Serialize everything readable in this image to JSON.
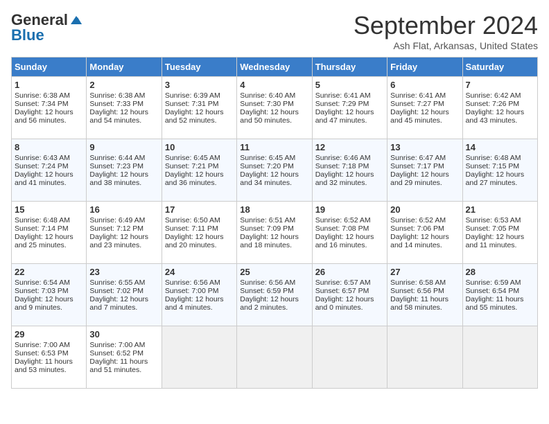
{
  "header": {
    "logo_line1": "General",
    "logo_line2": "Blue",
    "month": "September 2024",
    "location": "Ash Flat, Arkansas, United States"
  },
  "days_of_week": [
    "Sunday",
    "Monday",
    "Tuesday",
    "Wednesday",
    "Thursday",
    "Friday",
    "Saturday"
  ],
  "weeks": [
    [
      {
        "day": "1",
        "info": "Sunrise: 6:38 AM\nSunset: 7:34 PM\nDaylight: 12 hours and 56 minutes."
      },
      {
        "day": "2",
        "info": "Sunrise: 6:38 AM\nSunset: 7:33 PM\nDaylight: 12 hours and 54 minutes."
      },
      {
        "day": "3",
        "info": "Sunrise: 6:39 AM\nSunset: 7:31 PM\nDaylight: 12 hours and 52 minutes."
      },
      {
        "day": "4",
        "info": "Sunrise: 6:40 AM\nSunset: 7:30 PM\nDaylight: 12 hours and 50 minutes."
      },
      {
        "day": "5",
        "info": "Sunrise: 6:41 AM\nSunset: 7:29 PM\nDaylight: 12 hours and 47 minutes."
      },
      {
        "day": "6",
        "info": "Sunrise: 6:41 AM\nSunset: 7:27 PM\nDaylight: 12 hours and 45 minutes."
      },
      {
        "day": "7",
        "info": "Sunrise: 6:42 AM\nSunset: 7:26 PM\nDaylight: 12 hours and 43 minutes."
      }
    ],
    [
      {
        "day": "8",
        "info": "Sunrise: 6:43 AM\nSunset: 7:24 PM\nDaylight: 12 hours and 41 minutes."
      },
      {
        "day": "9",
        "info": "Sunrise: 6:44 AM\nSunset: 7:23 PM\nDaylight: 12 hours and 38 minutes."
      },
      {
        "day": "10",
        "info": "Sunrise: 6:45 AM\nSunset: 7:21 PM\nDaylight: 12 hours and 36 minutes."
      },
      {
        "day": "11",
        "info": "Sunrise: 6:45 AM\nSunset: 7:20 PM\nDaylight: 12 hours and 34 minutes."
      },
      {
        "day": "12",
        "info": "Sunrise: 6:46 AM\nSunset: 7:18 PM\nDaylight: 12 hours and 32 minutes."
      },
      {
        "day": "13",
        "info": "Sunrise: 6:47 AM\nSunset: 7:17 PM\nDaylight: 12 hours and 29 minutes."
      },
      {
        "day": "14",
        "info": "Sunrise: 6:48 AM\nSunset: 7:15 PM\nDaylight: 12 hours and 27 minutes."
      }
    ],
    [
      {
        "day": "15",
        "info": "Sunrise: 6:48 AM\nSunset: 7:14 PM\nDaylight: 12 hours and 25 minutes."
      },
      {
        "day": "16",
        "info": "Sunrise: 6:49 AM\nSunset: 7:12 PM\nDaylight: 12 hours and 23 minutes."
      },
      {
        "day": "17",
        "info": "Sunrise: 6:50 AM\nSunset: 7:11 PM\nDaylight: 12 hours and 20 minutes."
      },
      {
        "day": "18",
        "info": "Sunrise: 6:51 AM\nSunset: 7:09 PM\nDaylight: 12 hours and 18 minutes."
      },
      {
        "day": "19",
        "info": "Sunrise: 6:52 AM\nSunset: 7:08 PM\nDaylight: 12 hours and 16 minutes."
      },
      {
        "day": "20",
        "info": "Sunrise: 6:52 AM\nSunset: 7:06 PM\nDaylight: 12 hours and 14 minutes."
      },
      {
        "day": "21",
        "info": "Sunrise: 6:53 AM\nSunset: 7:05 PM\nDaylight: 12 hours and 11 minutes."
      }
    ],
    [
      {
        "day": "22",
        "info": "Sunrise: 6:54 AM\nSunset: 7:03 PM\nDaylight: 12 hours and 9 minutes."
      },
      {
        "day": "23",
        "info": "Sunrise: 6:55 AM\nSunset: 7:02 PM\nDaylight: 12 hours and 7 minutes."
      },
      {
        "day": "24",
        "info": "Sunrise: 6:56 AM\nSunset: 7:00 PM\nDaylight: 12 hours and 4 minutes."
      },
      {
        "day": "25",
        "info": "Sunrise: 6:56 AM\nSunset: 6:59 PM\nDaylight: 12 hours and 2 minutes."
      },
      {
        "day": "26",
        "info": "Sunrise: 6:57 AM\nSunset: 6:57 PM\nDaylight: 12 hours and 0 minutes."
      },
      {
        "day": "27",
        "info": "Sunrise: 6:58 AM\nSunset: 6:56 PM\nDaylight: 11 hours and 58 minutes."
      },
      {
        "day": "28",
        "info": "Sunrise: 6:59 AM\nSunset: 6:54 PM\nDaylight: 11 hours and 55 minutes."
      }
    ],
    [
      {
        "day": "29",
        "info": "Sunrise: 7:00 AM\nSunset: 6:53 PM\nDaylight: 11 hours and 53 minutes."
      },
      {
        "day": "30",
        "info": "Sunrise: 7:00 AM\nSunset: 6:52 PM\nDaylight: 11 hours and 51 minutes."
      },
      {
        "day": "",
        "info": ""
      },
      {
        "day": "",
        "info": ""
      },
      {
        "day": "",
        "info": ""
      },
      {
        "day": "",
        "info": ""
      },
      {
        "day": "",
        "info": ""
      }
    ]
  ]
}
